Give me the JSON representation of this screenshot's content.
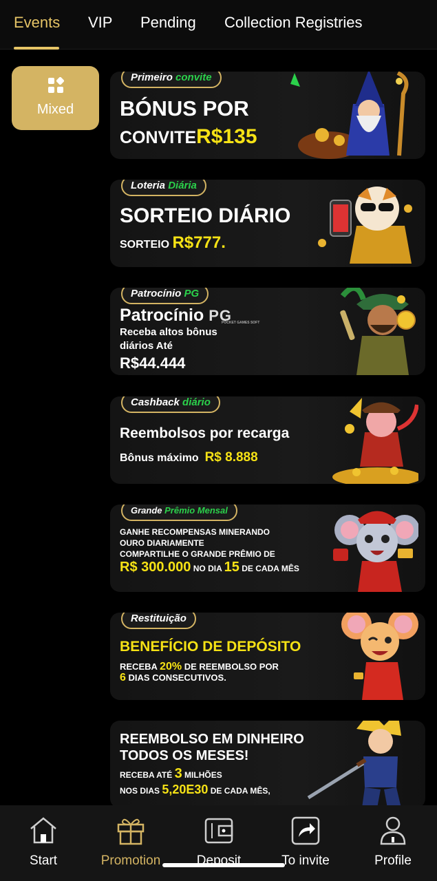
{
  "tabs": [
    {
      "label": "Events"
    },
    {
      "label": "VIP"
    },
    {
      "label": "Pending"
    },
    {
      "label": "Collection Registries"
    }
  ],
  "filter": {
    "label": "Mixed",
    "icon": "grid-icon"
  },
  "banners": [
    {
      "pill": [
        "Primeiro ",
        "convite"
      ],
      "lines": [
        "BÓNUS POR",
        "CONVITE",
        "R$135"
      ],
      "art": "wizard-icon"
    },
    {
      "pill": [
        "Loteria ",
        "Diária"
      ],
      "lines": [
        "SORTEIO DIÁRIO",
        "SORTEIO",
        "R$777."
      ],
      "art": "tiger-icon"
    },
    {
      "pill": [
        "Patrocínio ",
        "PG"
      ],
      "lines": [
        "Patrocínio",
        "PG",
        "POCKET GAMES SOFT",
        "Receba altos bônus",
        "diários Até",
        "R$44.444"
      ],
      "art": "explorer-icon"
    },
    {
      "pill": [
        "Cashback ",
        "diário"
      ],
      "lines": [
        "Reembolsos por recarga",
        "Bônus máximo",
        "R$ 8.888"
      ],
      "art": "ox-icon"
    },
    {
      "pill": [
        "Grande ",
        "Prêmio Mensal"
      ],
      "lines": [
        "GANHE RECOMPENSAS MINERANDO",
        "OURO DIARIAMENTE",
        "COMPARTILHE O GRANDE PRÊMIO DE",
        "R$ 300.000",
        "NO DIA",
        "15",
        "DE CADA MÊS"
      ],
      "art": "mouse-icon"
    },
    {
      "pill": [
        "Restituição",
        ""
      ],
      "lines": [
        "BENEFÍCIO DE DEPÓSITO",
        "RECEBA",
        "20%",
        "DE REEMBOLSO POR",
        "6",
        "DIAS CONSECUTIVOS."
      ],
      "art": "mouse-red-icon"
    },
    {
      "pill": [
        "",
        ""
      ],
      "lines": [
        "REEMBOLSO EM DINHEIRO",
        "TODOS OS MESES!",
        "RECEBA ATÉ",
        "3",
        "MILHÕES",
        "NOS DIAS",
        "5,20E30",
        "DE CADA MÊS,"
      ],
      "art": "warrior-icon"
    }
  ],
  "bottom_nav": [
    {
      "label": "Start",
      "icon": "home-icon"
    },
    {
      "label": "Promotion",
      "icon": "gift-icon"
    },
    {
      "label": "Deposit",
      "icon": "wallet-icon"
    },
    {
      "label": "To invite",
      "icon": "share-icon"
    },
    {
      "label": "Profile",
      "icon": "user-icon"
    }
  ],
  "colors": {
    "accent": "#d4b463",
    "highlight": "#f6e215",
    "green": "#2bd14b"
  }
}
